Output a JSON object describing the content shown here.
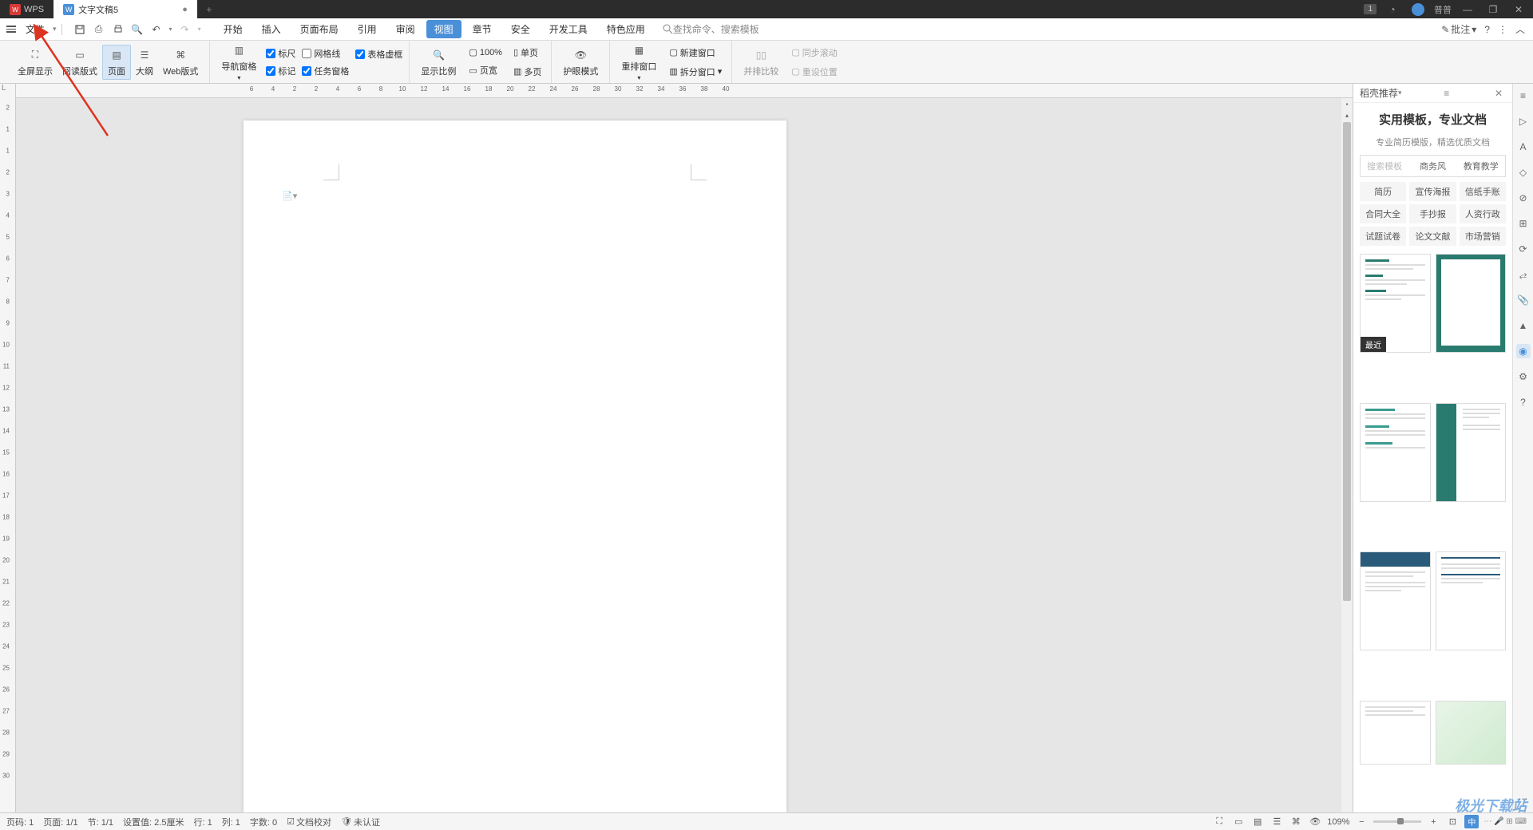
{
  "titlebar": {
    "home_tab": "WPS",
    "doc_tab": "文字文稿5",
    "modified": "●",
    "badge": "1",
    "username": "普普"
  },
  "menubar": {
    "file": "文件",
    "tabs": [
      "开始",
      "插入",
      "页面布局",
      "引用",
      "审阅",
      "视图",
      "章节",
      "安全",
      "开发工具",
      "特色应用"
    ],
    "active_tab": "视图",
    "search_placeholder": "查找命令、搜索模板",
    "annotation": "批注"
  },
  "ribbon": {
    "fullscreen": "全屏显示",
    "read_mode": "阅读版式",
    "page_view": "页面",
    "outline": "大纲",
    "web_view": "Web版式",
    "nav_pane": "导航窗格",
    "ruler": "标尺",
    "gridlines": "网格线",
    "table_grid": "表格虚框",
    "markup": "标记",
    "task_pane": "任务窗格",
    "zoom": "显示比例",
    "pct100": "100%",
    "page_width": "页宽",
    "single_page": "单页",
    "multi_page": "多页",
    "eye_protect": "护眼模式",
    "arrange": "重排窗口",
    "new_window": "新建窗口",
    "split": "拆分窗口",
    "compare": "并排比较",
    "sync_scroll": "同步滚动",
    "reset_pos": "重设位置"
  },
  "ruler_top_nums": [
    "6",
    "4",
    "2",
    "2",
    "4",
    "6",
    "8",
    "10",
    "12",
    "14",
    "16",
    "18",
    "20",
    "22",
    "24",
    "26",
    "28",
    "30",
    "32",
    "34",
    "36",
    "38",
    "40"
  ],
  "ruler_left_nums": [
    "2",
    "1",
    "1",
    "2",
    "3",
    "4",
    "5",
    "6",
    "7",
    "8",
    "9",
    "10",
    "11",
    "12",
    "13",
    "14",
    "15",
    "16",
    "17",
    "18",
    "19",
    "20",
    "21",
    "22",
    "23",
    "24",
    "25",
    "26",
    "27",
    "28",
    "29",
    "30"
  ],
  "right_panel": {
    "header": "稻壳推荐",
    "title": "实用模板，专业文档",
    "subtitle": "专业简历模版，精选优质文档",
    "tabs": [
      "搜索模板",
      "商务风",
      "教育教学"
    ],
    "tags": [
      "简历",
      "宣传海报",
      "信纸手账",
      "合同大全",
      "手抄报",
      "人资行政",
      "试题试卷",
      "论文文献",
      "市场营销"
    ],
    "recent": "最近"
  },
  "statusbar": {
    "page_num": "页码: 1",
    "page_count": "页面: 1/1",
    "section": "节: 1/1",
    "ruler_pos": "设置值: 2.5厘米",
    "row": "行: 1",
    "col": "列: 1",
    "word_count": "字数: 0",
    "spellcheck": "文档校对",
    "auth": "未认证",
    "zoom": "109%",
    "ime": "中"
  },
  "watermark": "极光下载站"
}
